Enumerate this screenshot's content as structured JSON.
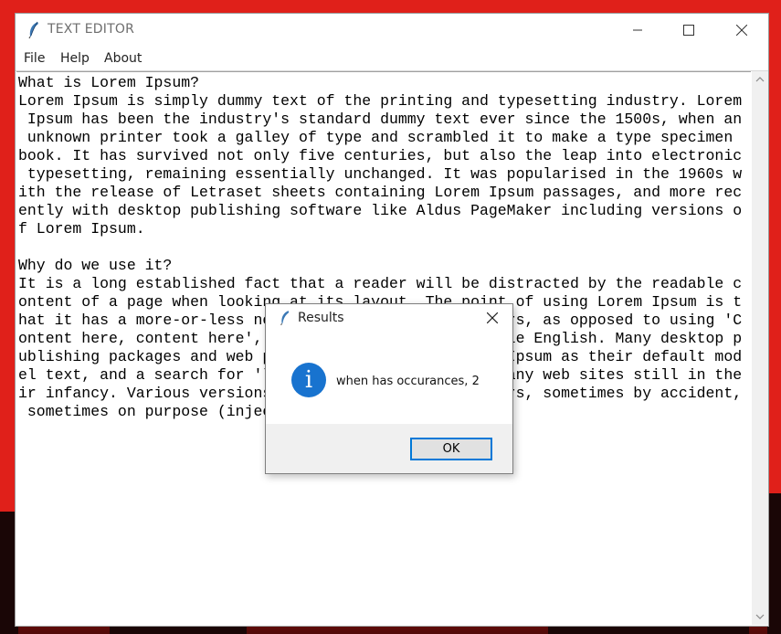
{
  "window": {
    "title": "TEXT EDITOR"
  },
  "menubar": {
    "items": [
      "File",
      "Help",
      "About"
    ]
  },
  "editor": {
    "content": "What is Lorem Ipsum?\nLorem Ipsum is simply dummy text of the printing and typesetting industry. Lorem\n Ipsum has been the industry's standard dummy text ever since the 1500s, when an\n unknown printer took a galley of type and scrambled it to make a type specimen\nbook. It has survived not only five centuries, but also the leap into electronic\n typesetting, remaining essentially unchanged. It was popularised in the 1960s w\nith the release of Letraset sheets containing Lorem Ipsum passages, and more rec\nently with desktop publishing software like Aldus PageMaker including versions o\nf Lorem Ipsum.\n\nWhy do we use it?\nIt is a long established fact that a reader will be distracted by the readable c\nontent of a page when looking at its layout. The point of using Lorem Ipsum is t\nhat it has a more-or-less normal distribution of letters, as opposed to using 'C\nontent here, content here', making it look like readable English. Many desktop p\nublishing packages and web page editors now use Lorem Ipsum as their default mod\nel text, and a search for 'lorem ipsum' will uncover many web sites still in the\nir infancy. Various versions have evolved over the years, sometimes by accident,\n sometimes on purpose (injected humour and the like)."
  },
  "dialog": {
    "title": "Results",
    "message": "when has occurances, 2",
    "ok_label": "OK",
    "icon": "info-icon"
  },
  "colors": {
    "desktop": "#e0201a",
    "info_icon": "#1873cf",
    "ok_border": "#0078d7"
  }
}
